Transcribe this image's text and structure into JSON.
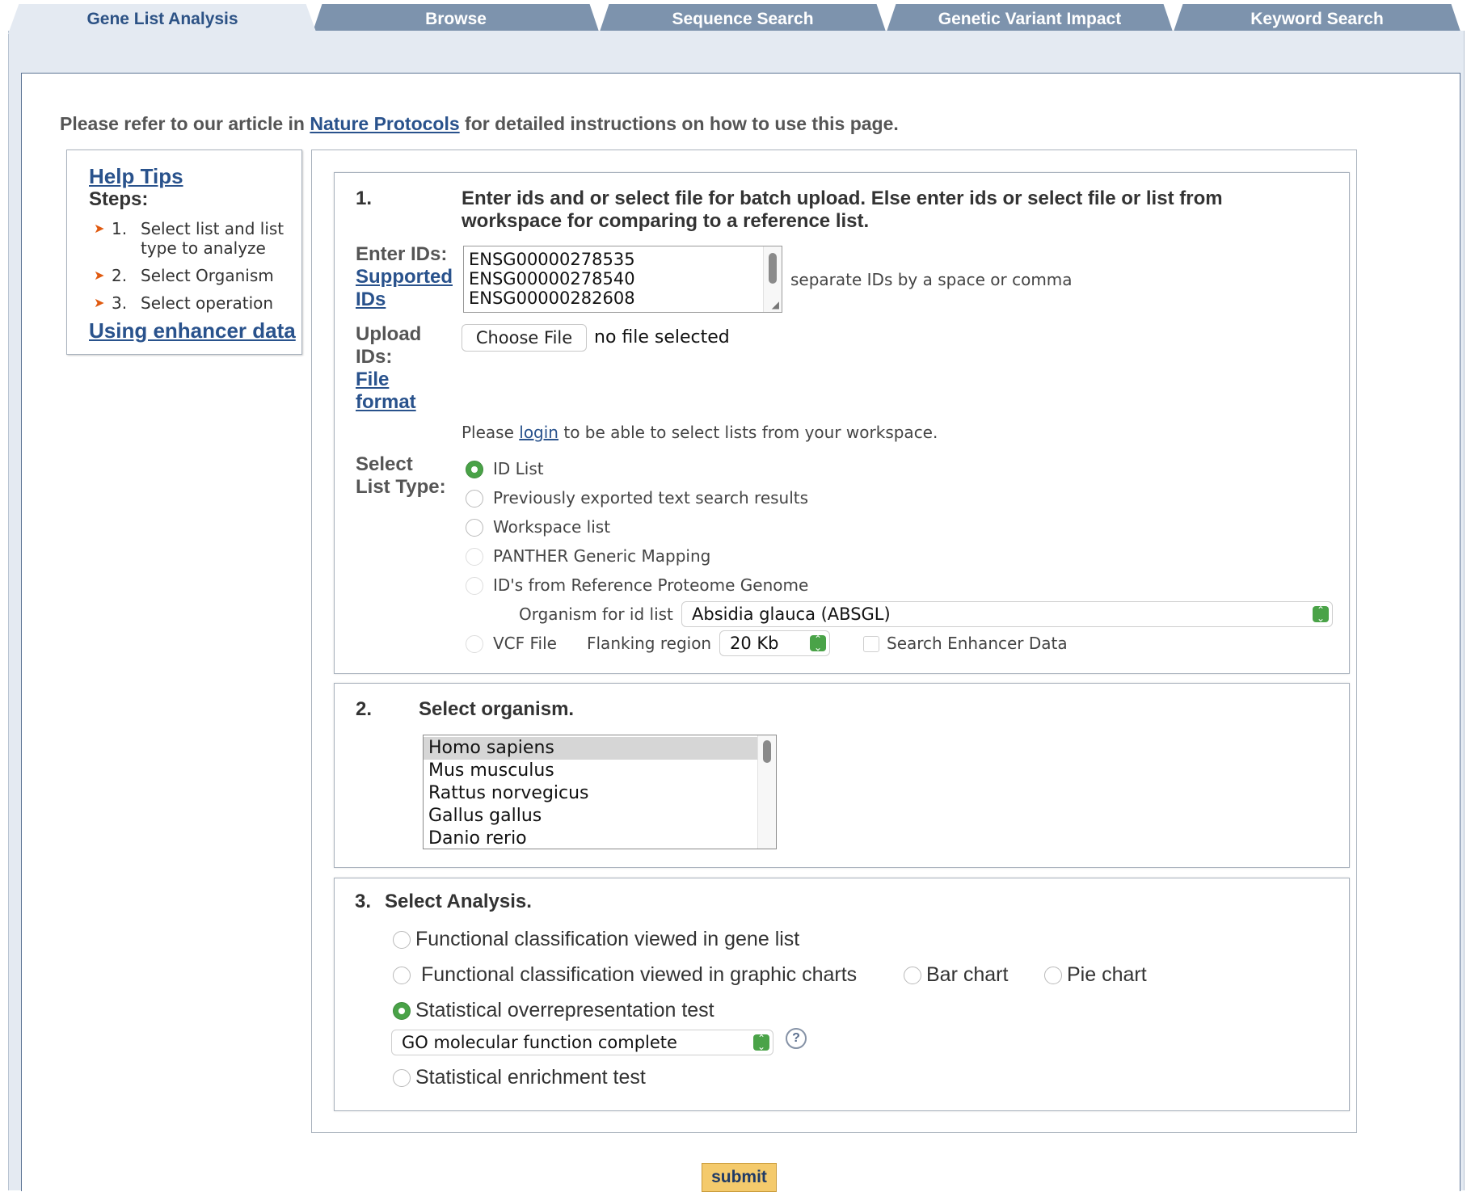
{
  "tabs": [
    {
      "label": "Gene List Analysis",
      "active": true
    },
    {
      "label": "Browse"
    },
    {
      "label": "Sequence Search"
    },
    {
      "label": "Genetic Variant Impact"
    },
    {
      "label": "Keyword Search"
    }
  ],
  "intro": {
    "prefix": "Please refer to our article in ",
    "link": "Nature Protocols",
    "suffix": " for detailed instructions on how to use this page."
  },
  "help": {
    "title": "Help Tips",
    "steps_title": "Steps:",
    "steps": [
      {
        "num": "1.",
        "text": "Select list and list type to analyze"
      },
      {
        "num": "2.",
        "text": "Select Organism"
      },
      {
        "num": "3.",
        "text": "Select operation"
      }
    ],
    "enhancer_link": "Using enhancer data"
  },
  "section1": {
    "number": "1.",
    "heading": "Enter ids and or select file for batch upload. Else enter ids or select file or list from workspace for comparing to a reference list.",
    "enter_ids_label": "Enter IDs:",
    "supported_ids_link": "Supported IDs",
    "ids_textarea": [
      "ENSG00000278535",
      "ENSG00000278540",
      "ENSG00000282608"
    ],
    "separator_hint": "separate IDs by a space or comma",
    "upload_label": "Upload IDs:",
    "file_format_link": "File format",
    "choose_file_button": "Choose File",
    "no_file_text": "no file selected",
    "login_prefix": "Please ",
    "login_link": "login",
    "login_suffix": " to be able to select lists from your workspace.",
    "list_type_label": "Select List Type:",
    "list_types": [
      {
        "label": "ID List",
        "checked": true
      },
      {
        "label": "Previously exported text search results"
      },
      {
        "label": "Workspace list"
      },
      {
        "label": "PANTHER Generic Mapping"
      },
      {
        "label": "ID's from Reference Proteome Genome"
      }
    ],
    "organism_for_id_label": "Organism for id list",
    "organism_for_id_value": "Absidia glauca (ABSGL)",
    "vcf_label": "VCF File",
    "flanking_label": "Flanking region",
    "flanking_value": "20 Kb",
    "enhancer_checkbox_label": "Search Enhancer Data"
  },
  "section2": {
    "number": "2.",
    "heading": "Select organism.",
    "organisms": [
      "Homo sapiens",
      "Mus musculus",
      "Rattus norvegicus",
      "Gallus gallus",
      "Danio rerio"
    ],
    "selected": "Homo sapiens"
  },
  "section3": {
    "number": "3.",
    "heading": "Select Analysis.",
    "opt_gene_list": "Functional classification viewed in gene list",
    "opt_graphic": "Functional classification viewed in graphic charts",
    "opt_bar": "Bar chart",
    "opt_pie": "Pie chart",
    "opt_overrep": "Statistical overrepresentation test",
    "overrep_select_value": "GO molecular function complete",
    "help_icon": "?",
    "opt_enrichment": "Statistical enrichment test",
    "checked": "Statistical overrepresentation test"
  },
  "submit_label": "submit",
  "colors": {
    "tab_active_bg": "#e4eaf2",
    "tab_bg": "#7d93ad",
    "link": "#29528c",
    "radio_checked": "#49a247",
    "submit_bg": "#f4ca6c"
  }
}
